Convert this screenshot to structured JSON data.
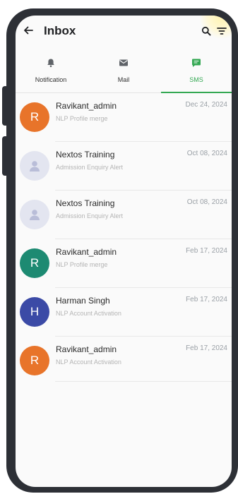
{
  "header": {
    "title": "Inbox",
    "back_icon": "arrow-left-icon",
    "search_icon": "search-icon",
    "filter_icon": "filter-icon"
  },
  "tabs": [
    {
      "label": "Notification",
      "icon": "bell-icon",
      "active": false
    },
    {
      "label": "Mail",
      "icon": "mail-icon",
      "active": false
    },
    {
      "label": "SMS",
      "icon": "chat-icon",
      "active": true
    }
  ],
  "colors": {
    "accent": "#34a853",
    "avatar_orange": "#e8742a",
    "avatar_teal": "#1d8a72",
    "avatar_indigo": "#3b4aa6"
  },
  "messages": [
    {
      "sender": "Ravikant_admin",
      "subject": "NLP Profile merge",
      "date": "Dec 24, 2024",
      "avatar_letter": "R",
      "avatar_color": "#e8742a"
    },
    {
      "sender": "Nextos Training",
      "subject": "Admission Enquiry Alert",
      "date": "Oct 08, 2024",
      "avatar_letter": "",
      "avatar_color": "#e3e5f0"
    },
    {
      "sender": "Nextos Training",
      "subject": "Admission Enquiry Alert",
      "date": "Oct 08, 2024",
      "avatar_letter": "",
      "avatar_color": "#e3e5f0"
    },
    {
      "sender": "Ravikant_admin",
      "subject": "NLP Profile merge",
      "date": "Feb 17, 2024",
      "avatar_letter": "R",
      "avatar_color": "#1d8a72"
    },
    {
      "sender": "Harman Singh",
      "subject": "NLP Account Activation",
      "date": "Feb 17, 2024",
      "avatar_letter": "H",
      "avatar_color": "#3b4aa6"
    },
    {
      "sender": "Ravikant_admin",
      "subject": "NLP Account Activation",
      "date": "Feb 17, 2024",
      "avatar_letter": "R",
      "avatar_color": "#e8742a"
    }
  ]
}
